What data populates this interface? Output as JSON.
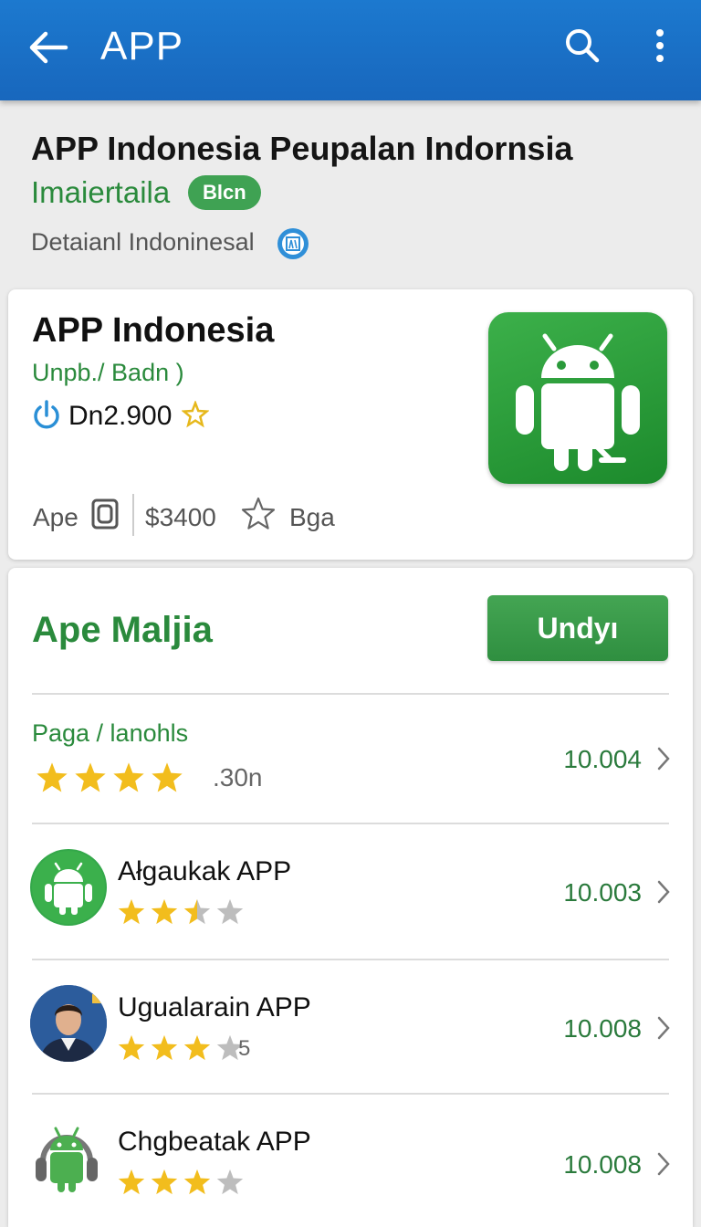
{
  "appbar": {
    "title": "APP"
  },
  "header": {
    "title": "APP Indonesia Peupalan Indornsia",
    "subtitle": "Imaiertaila",
    "badge": "Blcn",
    "detail": "Detaianl Indoninesal"
  },
  "app_card": {
    "name": "APP Indonesia",
    "developer": "Unpb./ Badn )",
    "downloads": "Dn2.900",
    "meta_label": "Ape",
    "price": "$3400",
    "meta_tag": "Bga"
  },
  "section": {
    "title": "Ape Maljia",
    "button_label": "Undyı"
  },
  "rows": [
    {
      "name": "Paga / lanohls",
      "extra": ".30n",
      "value": "10.004",
      "stars": 4
    },
    {
      "name": "Ałgaukak APP",
      "value": "10.003",
      "stars": 2.5
    },
    {
      "name": "Ugualarain APP",
      "extra": "5",
      "value": "10.008",
      "stars": 3
    },
    {
      "name": "Chgbeatak APP",
      "value": "10.008",
      "stars": 3
    }
  ],
  "colors": {
    "appbar": "#1c79cf",
    "accent_green": "#2a8a3c",
    "button_green": "#3fa253",
    "star_gold": "#f2bd1d"
  }
}
